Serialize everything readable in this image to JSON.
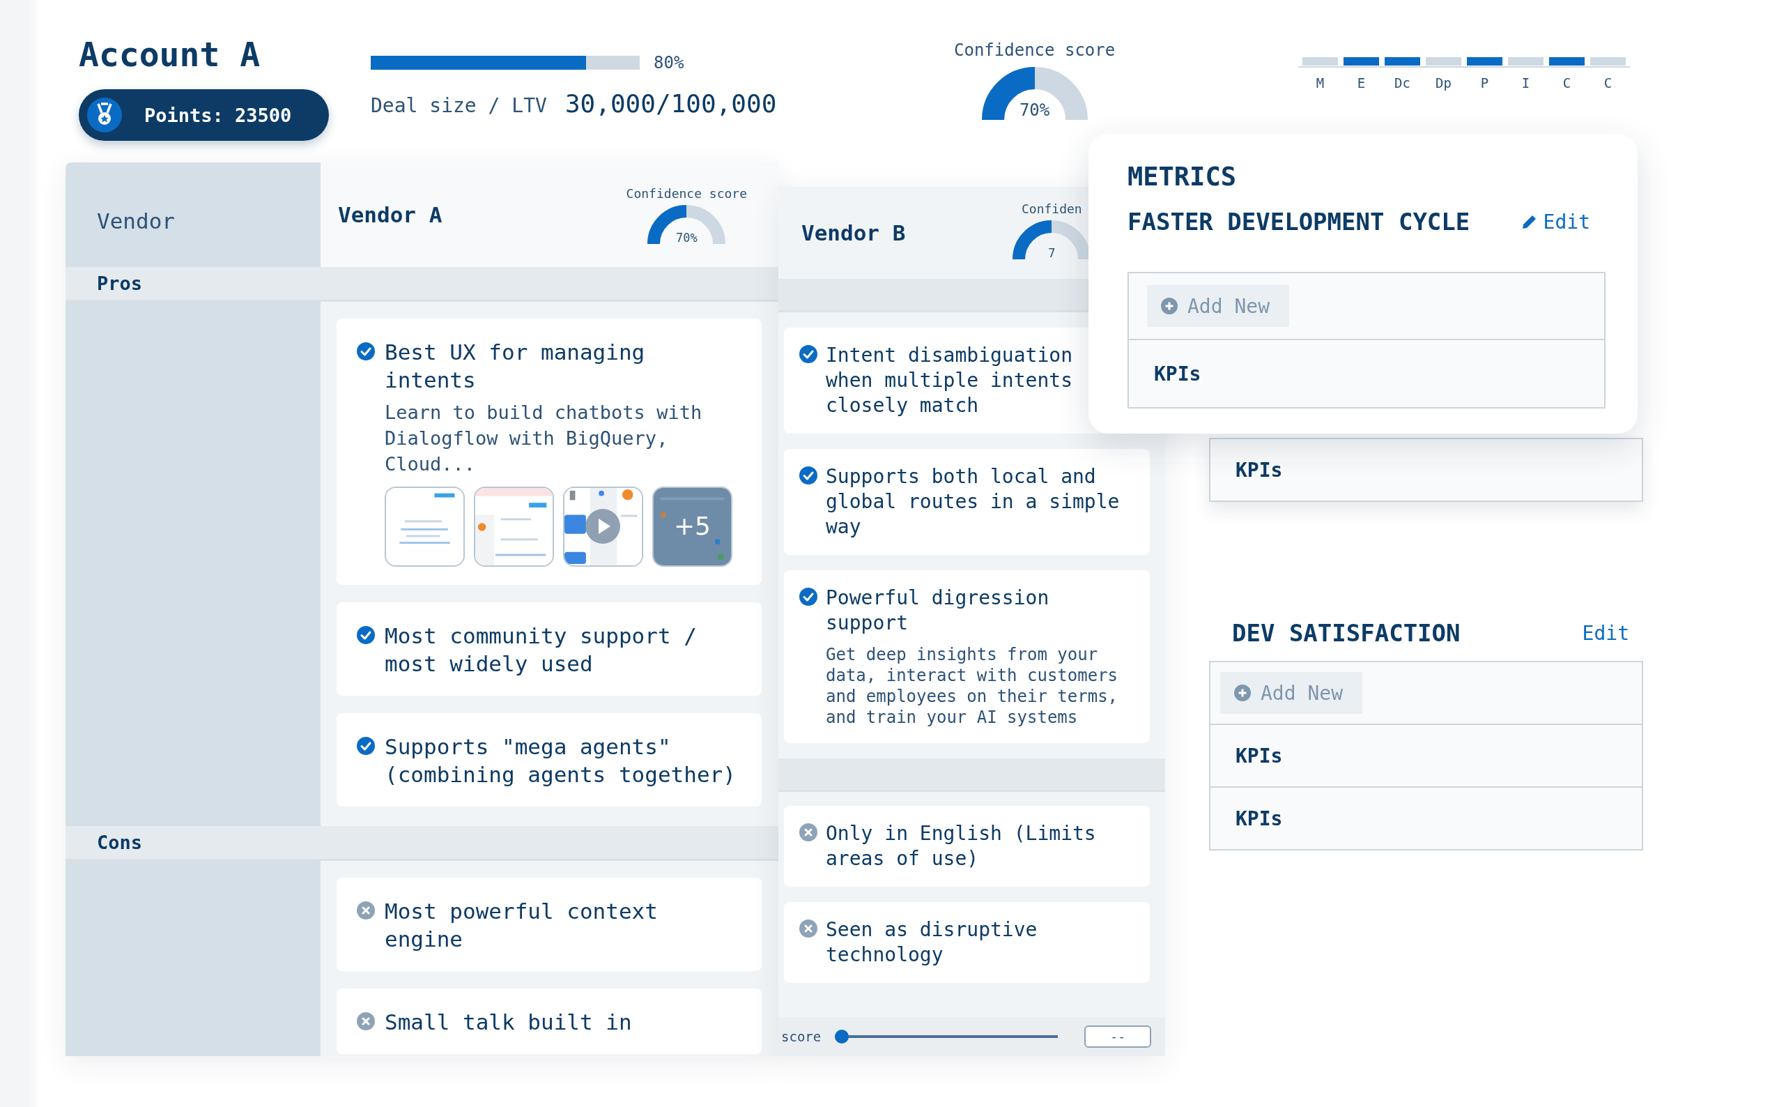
{
  "account": {
    "title": "Account A",
    "points": "Points: 23500"
  },
  "deal": {
    "level": 0.8,
    "percent": "80%",
    "label": "Deal size / LTV",
    "value": "30,000/100,000"
  },
  "confidence": {
    "label": "Confidence score",
    "level": 0.5,
    "value": "70%"
  },
  "stages": [
    {
      "label": "M",
      "on": false
    },
    {
      "label": "E",
      "on": true
    },
    {
      "label": "Dc",
      "on": true
    },
    {
      "label": "Dp",
      "on": false
    },
    {
      "label": "P",
      "on": true
    },
    {
      "label": "I",
      "on": false
    },
    {
      "label": "C",
      "on": true
    },
    {
      "label": "C",
      "on": false
    }
  ],
  "comparison": {
    "row_header": "Vendor",
    "sections": [
      "Pros",
      "Cons"
    ]
  },
  "vendors": [
    {
      "name": "Vendor A",
      "confidence": {
        "label": "Confidence score",
        "level": 0.5,
        "value": "70%"
      },
      "pros": [
        {
          "title": "Best UX for managing intents",
          "description": "Learn to build chatbots with Dialogflow with BigQuery, Cloud...",
          "media": {
            "items": [
              {
                "kind": "picture"
              },
              {
                "kind": "picture"
              },
              {
                "kind": "video"
              },
              {
                "kind": "more"
              }
            ],
            "more": "+5"
          }
        },
        {
          "title": "Most community support / most widely used"
        },
        {
          "title": "Supports \"mega agents\" (combining agents together)"
        }
      ],
      "cons": [
        {
          "title": "Most powerful context engine"
        },
        {
          "title": "Small talk built in"
        }
      ]
    },
    {
      "name": "Vendor B",
      "confidence": {
        "label": "Confiden",
        "level": 0.5,
        "value": "7"
      },
      "pros": [
        {
          "title": "Intent disambiguation when multiple intents closely match"
        },
        {
          "title": "Supports both local and global routes in a simple way"
        },
        {
          "title": "Powerful digression support",
          "description": "Get deep insights from your data, interact with customers and employees on their terms, and train your AI systems"
        }
      ],
      "cons": [
        {
          "title": "Only in English (Limits areas of use)"
        },
        {
          "title": "Seen as disruptive technology"
        }
      ],
      "score": {
        "label": "score",
        "level": 0,
        "value": "--"
      }
    }
  ],
  "metrics": {
    "title": "METRICS",
    "group": {
      "title": "FASTER DEVELOPMENT CYCLE",
      "edit": "Edit",
      "edit_icon": true,
      "add": "Add New",
      "rows": [
        "KPIs"
      ]
    }
  },
  "background_groups": [
    {
      "rows": [
        "KPIs"
      ]
    },
    {
      "title": "DEV SATISFACTION",
      "edit": "Edit",
      "edit_icon": false,
      "add": "Add New",
      "rows": [
        "KPIs",
        "KPIs"
      ]
    }
  ]
}
